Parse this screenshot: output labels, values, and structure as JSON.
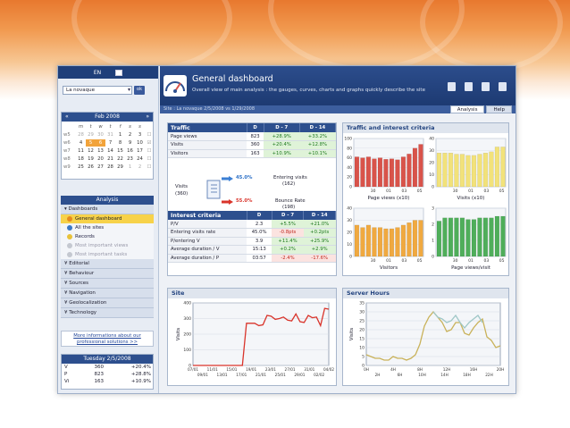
{
  "sidebar": {
    "lang": "EN",
    "site_select": "La novaque",
    "ok": "ok",
    "calendar": {
      "month": "Feb 2008",
      "weekdays": [
        "m",
        "t",
        "w",
        "t",
        "f",
        "s",
        "s"
      ],
      "weeks": [
        {
          "wk": "w5",
          "days": [
            "28",
            "29",
            "30",
            "31",
            "1",
            "2",
            "3"
          ]
        },
        {
          "wk": "w6",
          "days": [
            "4",
            "5",
            "6",
            "7",
            "8",
            "9",
            "10"
          ]
        },
        {
          "wk": "w7",
          "days": [
            "11",
            "12",
            "13",
            "14",
            "15",
            "16",
            "17"
          ]
        },
        {
          "wk": "w8",
          "days": [
            "18",
            "19",
            "20",
            "21",
            "22",
            "23",
            "24"
          ]
        },
        {
          "wk": "w9",
          "days": [
            "25",
            "26",
            "27",
            "28",
            "29",
            "1",
            "2"
          ]
        }
      ]
    },
    "analysis_title": "Analysis",
    "sections": [
      {
        "label": "Dashboards"
      },
      {
        "label": "Editorial"
      },
      {
        "label": "Behaviour"
      },
      {
        "label": "Sources"
      },
      {
        "label": "Navigation"
      },
      {
        "label": "Geolocalization"
      },
      {
        "label": "Technology"
      }
    ],
    "dashboard_items": [
      "General dashboard",
      "All the sites",
      "Records",
      "Most important views",
      "Most important tasks"
    ],
    "info_link": "More informations about our professional solutions >>",
    "day": {
      "title": "Tuesday 2/5/2008",
      "rows": [
        {
          "k": "V",
          "v": "360",
          "p": "+20.4%"
        },
        {
          "k": "P",
          "v": "823",
          "p": "+28.8%"
        },
        {
          "k": "Vi",
          "v": "163",
          "p": "+10.9%"
        }
      ]
    }
  },
  "header": {
    "title": "General dashboard",
    "subtitle": "Overall view of main analysis : the gauges, curves, charts and graphs quickly describe the site",
    "site_line": "Site : La novaque    2/5/2008 vs 1/29/2008",
    "tabs": [
      "Analysis",
      "Help"
    ]
  },
  "traffic": {
    "title": "Traffic",
    "cols": [
      "D",
      "D - 7",
      "D - 14"
    ],
    "rows": [
      {
        "label": "Page views",
        "d": "823",
        "d7": "+28.9%",
        "d14": "+33.2%"
      },
      {
        "label": "Visits",
        "d": "360",
        "d7": "+20.4%",
        "d14": "+12.8%"
      },
      {
        "label": "Visitors",
        "d": "163",
        "d7": "+10.9%",
        "d14": "+10.1%"
      }
    ],
    "flow": {
      "visits_label": "Visits",
      "visits_value": "(360)",
      "entering_pct": "45.0%",
      "entering_label": "Entering visits",
      "entering_value": "(162)",
      "bounce_pct": "55.0%",
      "bounce_label": "Bounce Rate",
      "bounce_value": "(198)"
    }
  },
  "interest": {
    "title": "Interest criteria",
    "cols": [
      "D",
      "D - 7",
      "D - 14"
    ],
    "rows": [
      {
        "label": "P/V",
        "d": "2.3",
        "d7": "+5.5%",
        "d14": "+21.0%",
        "c7": "g",
        "c14": "g"
      },
      {
        "label": "Entering visits rate",
        "d": "45.0%",
        "d7": "-0.8pts",
        "d14": "+0.2pts",
        "c7": "r",
        "c14": "g"
      },
      {
        "label": "P/entering V",
        "d": "3.9",
        "d7": "+11.4%",
        "d14": "+25.9%",
        "c7": "g",
        "c14": "g"
      },
      {
        "label": "Average duration / V",
        "d": "15:13",
        "d7": "+0.2%",
        "d14": "+2.9%",
        "c7": "g",
        "c14": "g"
      },
      {
        "label": "Average duration / P",
        "d": "03:57",
        "d7": "-2.4%",
        "d14": "-17.6%",
        "c7": "r",
        "c14": "r"
      }
    ]
  },
  "traffic_interest_card": {
    "title": "Traffic and interest criteria"
  },
  "site_card": {
    "title": "Site"
  },
  "server_card": {
    "title": "Server Hours"
  },
  "colors": {
    "red": "#d9534a",
    "yellow": "#f2e27a",
    "orange": "#f0a940",
    "green": "#4fae5a",
    "navy": "#2d4f8e"
  },
  "chart_data": [
    {
      "type": "bar",
      "xlabel": "Page views (x10)",
      "ylim": [
        0,
        100
      ],
      "yticks": [
        "100",
        "80",
        "60",
        "40",
        "20",
        "0"
      ],
      "xticks": [
        "30",
        "01",
        "03",
        "05"
      ],
      "values": [
        62,
        60,
        62,
        58,
        60,
        57,
        58,
        56,
        62,
        68,
        80,
        88
      ]
    },
    {
      "type": "bar",
      "xlabel": "Visits (x10)",
      "ylim": [
        0,
        40
      ],
      "yticks": [
        "40",
        "30",
        "20",
        "10",
        "0"
      ],
      "xticks": [
        "30",
        "01",
        "03",
        "05"
      ],
      "values": [
        28,
        28,
        28,
        27,
        27,
        26,
        26,
        27,
        28,
        29,
        33,
        33
      ]
    },
    {
      "type": "bar",
      "xlabel": "Visitors",
      "ylim": [
        0,
        40
      ],
      "yticks": [
        "40",
        "30",
        "20",
        "10",
        "0"
      ],
      "xticks": [
        "30",
        "01",
        "03",
        "05"
      ],
      "values": [
        26,
        24,
        26,
        24,
        24,
        23,
        23,
        24,
        26,
        28,
        30,
        30
      ]
    },
    {
      "type": "bar",
      "xlabel": "Page views/visit",
      "ylim": [
        0,
        3
      ],
      "yticks": [
        "3",
        "2",
        "1",
        "0"
      ],
      "xticks": [
        "30",
        "01",
        "03",
        "05"
      ],
      "values": [
        2.2,
        2.4,
        2.4,
        2.4,
        2.4,
        2.3,
        2.3,
        2.4,
        2.4,
        2.4,
        2.5,
        2.5
      ]
    },
    {
      "type": "line",
      "title": "Site",
      "ylabel": "Visits",
      "ylim": [
        0,
        400
      ],
      "yticks": [
        "400",
        "300",
        "200",
        "100",
        "0"
      ],
      "xticks_top": [
        "07/01",
        "11/01",
        "15/01",
        "19/01",
        "23/01",
        "27/01",
        "31/01",
        "04/02"
      ],
      "xticks_bottom": [
        "09/01",
        "13/01",
        "17/01",
        "21/01",
        "25/01",
        "29/01",
        "02/02"
      ],
      "values": [
        0,
        0,
        0,
        0,
        0,
        0,
        0,
        0,
        0,
        0,
        0,
        0,
        0,
        270,
        270,
        270,
        255,
        260,
        320,
        315,
        295,
        300,
        310,
        290,
        285,
        330,
        280,
        275,
        320,
        305,
        310,
        255,
        365,
        360
      ]
    },
    {
      "type": "line",
      "title": "Server Hours",
      "ylabel": "Visits",
      "ylim": [
        0,
        35
      ],
      "yticks": [
        "35",
        "30",
        "25",
        "20",
        "15",
        "10",
        "5",
        "0"
      ],
      "xticks_top": [
        "0H",
        "4H",
        "8H",
        "12H",
        "16H",
        "20H"
      ],
      "xticks_bottom": [
        "2H",
        "6H",
        "10H",
        "14H",
        "18H",
        "22H"
      ],
      "series": [
        {
          "color": "#c9b25a",
          "values": [
            6,
            5,
            4,
            4,
            3,
            3,
            5,
            4,
            4,
            3,
            4,
            6,
            12,
            22,
            27,
            30,
            27,
            24,
            19,
            20,
            24,
            24,
            18,
            17,
            21,
            24,
            26,
            16,
            14,
            10,
            11
          ]
        },
        {
          "color": "#9fc7c7",
          "values": [
            null,
            null,
            null,
            null,
            null,
            null,
            null,
            null,
            null,
            null,
            null,
            null,
            null,
            null,
            null,
            30,
            27,
            26,
            24,
            25,
            28,
            24,
            21,
            24,
            26,
            28,
            24,
            null,
            null,
            null,
            null
          ]
        }
      ]
    }
  ]
}
